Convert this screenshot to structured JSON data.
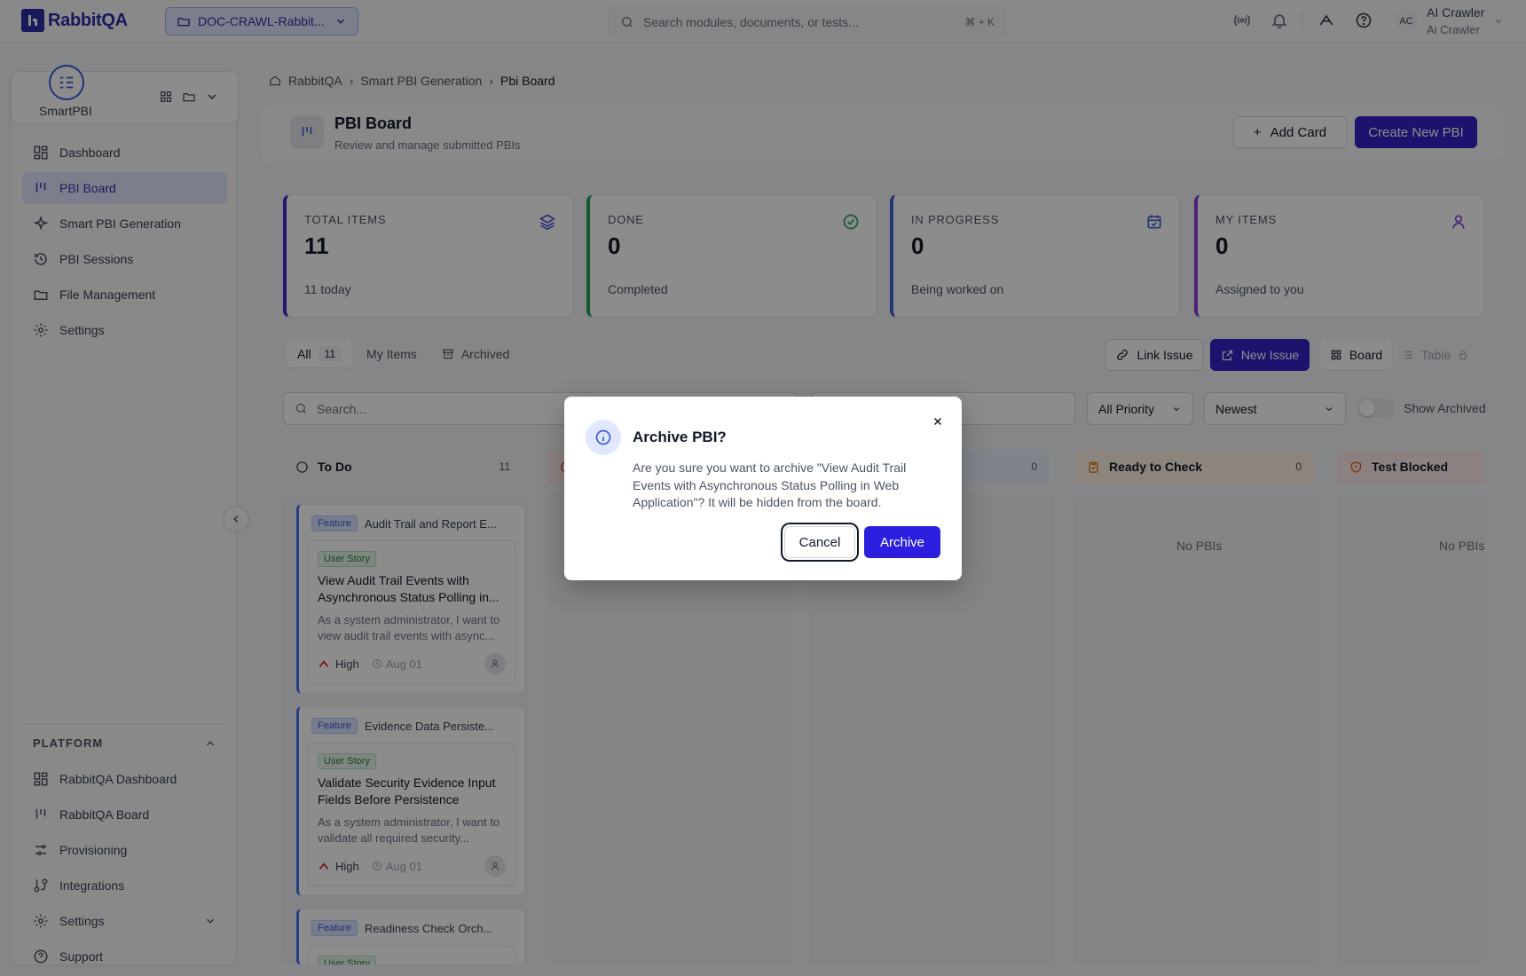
{
  "topbar": {
    "logo_text": "RabbitQA",
    "project": "DOC-CRAWL-Rabbit...",
    "search_placeholder": "Search modules, documents, or tests...",
    "search_shortcut": "⌘ + K",
    "user": {
      "initials": "AC",
      "name": "AI Crawler",
      "sub": "Ai Crawler"
    }
  },
  "sidebar": {
    "app_name": "SmartPBI",
    "items": [
      {
        "label": "Dashboard",
        "icon": "dashboard-icon"
      },
      {
        "label": "PBI Board",
        "icon": "board-icon",
        "active": true
      },
      {
        "label": "Smart PBI Generation",
        "icon": "sparkle-icon"
      },
      {
        "label": "PBI Sessions",
        "icon": "history-icon"
      },
      {
        "label": "File Management",
        "icon": "folder-icon"
      },
      {
        "label": "Settings",
        "icon": "gear-icon"
      }
    ],
    "platform": {
      "title": "PLATFORM",
      "items": [
        {
          "label": "RabbitQA Dashboard",
          "icon": "dashboard-icon"
        },
        {
          "label": "RabbitQA Board",
          "icon": "board-icon"
        },
        {
          "label": "Provisioning",
          "icon": "sliders-icon"
        },
        {
          "label": "Integrations",
          "icon": "integration-icon"
        },
        {
          "label": "Settings",
          "icon": "gear-icon"
        },
        {
          "label": "Support",
          "icon": "help-icon"
        }
      ]
    }
  },
  "breadcrumb": {
    "home": "RabbitQA",
    "parent": "Smart PBI Generation",
    "current": "Pbi Board"
  },
  "header": {
    "title": "PBI Board",
    "subtitle": "Review and manage submitted PBIs",
    "add_card": "Add Card",
    "create_new": "Create New PBI"
  },
  "stats": [
    {
      "label": "TOTAL ITEMS",
      "value": "11",
      "sub": "11 today",
      "color": "#3b2fc9",
      "icon": "layers-icon"
    },
    {
      "label": "DONE",
      "value": "0",
      "sub": "Completed",
      "color": "#22a35a",
      "icon": "check-circle-icon"
    },
    {
      "label": "IN PROGRESS",
      "value": "0",
      "sub": "Being worked on",
      "color": "#3b63d6",
      "icon": "calendar-icon"
    },
    {
      "label": "MY ITEMS",
      "value": "0",
      "sub": "Assigned to you",
      "color": "#8b3fd9",
      "icon": "user-icon"
    }
  ],
  "tabs": {
    "all": "All",
    "all_count": "11",
    "my_items": "My Items",
    "archived": "Archived"
  },
  "toolbar": {
    "link_issue": "Link Issue",
    "new_issue": "New Issue",
    "board": "Board",
    "table": "Table"
  },
  "filters": {
    "search_placeholder": "Search...",
    "priority": "All Priority",
    "sort": "Newest",
    "show_archived": "Show Archived"
  },
  "columns": {
    "todo": {
      "title": "To Do",
      "count": "11"
    },
    "hidden_count": "0",
    "ready": {
      "title": "Ready to Check",
      "count": "0",
      "empty": "No PBIs"
    },
    "blocked": {
      "title": "Test Blocked",
      "empty": "No PBIs"
    }
  },
  "cards": [
    {
      "feature_badge": "Feature",
      "feature": "Audit Trail and Report E...",
      "story_badge": "User Story",
      "title": "View Audit Trail Events with Asynchronous Status Polling in...",
      "desc": "As a system administrator, I want to view audit trail events with async...",
      "priority": "High",
      "date": "Aug 01"
    },
    {
      "feature_badge": "Feature",
      "feature": "Evidence Data Persiste...",
      "story_badge": "User Story",
      "title": "Validate Security Evidence Input Fields Before Persistence",
      "desc": "As a system administrator, I want to validate all required security...",
      "priority": "High",
      "date": "Aug 01"
    },
    {
      "feature_badge": "Feature",
      "feature": "Readiness Check Orch...",
      "story_badge": "User Story"
    }
  ],
  "modal": {
    "title": "Archive PBI?",
    "body": "Are you sure you want to archive \"View Audit Trail Events with Asynchronous Status Polling in Web Application\"? It will be hidden from the board.",
    "cancel": "Cancel",
    "confirm": "Archive"
  }
}
